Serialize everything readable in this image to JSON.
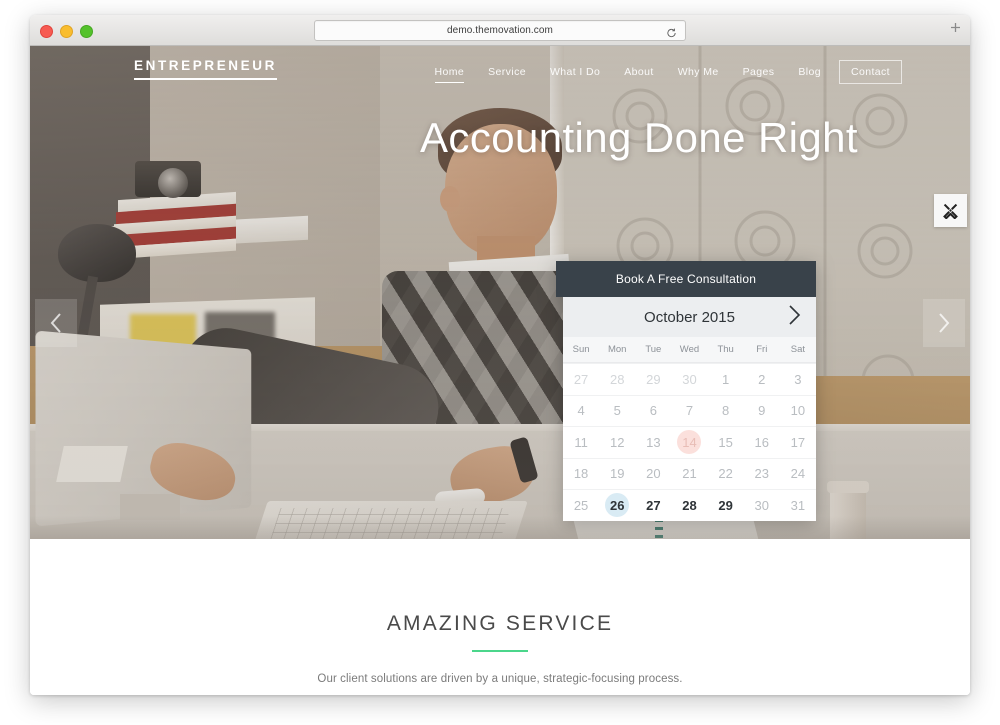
{
  "browser": {
    "url": "demo.themovation.com",
    "reload_icon": "reload-icon",
    "new_tab_icon": "plus-icon",
    "traffic_lights": [
      "close-red",
      "minimize-yellow",
      "maximize-green"
    ]
  },
  "header": {
    "logo": "ENTREPRENEUR",
    "nav": [
      {
        "label": "Home",
        "state": "active"
      },
      {
        "label": "Service",
        "state": "default"
      },
      {
        "label": "What I Do",
        "state": "default"
      },
      {
        "label": "About",
        "state": "default"
      },
      {
        "label": "Why Me",
        "state": "default"
      },
      {
        "label": "Pages",
        "state": "default"
      },
      {
        "label": "Blog",
        "state": "default"
      },
      {
        "label": "Contact",
        "state": "boxed"
      }
    ]
  },
  "hero": {
    "title": "Accounting Done Right",
    "prev_icon": "chevron-left-icon",
    "next_icon": "chevron-right-icon",
    "dots": [
      {
        "active": true
      },
      {
        "active": false
      }
    ],
    "tools_icon": "tools-icon"
  },
  "calendar": {
    "header": "Book A Free Consultation",
    "month": "October 2015",
    "next_icon": "chevron-right-icon",
    "weekdays": [
      "Sun",
      "Mon",
      "Tue",
      "Wed",
      "Thu",
      "Fri",
      "Sat"
    ],
    "days": [
      {
        "n": "27",
        "style": "muted"
      },
      {
        "n": "28",
        "style": "muted"
      },
      {
        "n": "29",
        "style": "muted"
      },
      {
        "n": "30",
        "style": "muted"
      },
      {
        "n": "1",
        "style": "normal"
      },
      {
        "n": "2",
        "style": "normal"
      },
      {
        "n": "3",
        "style": "normal"
      },
      {
        "n": "4",
        "style": "normal"
      },
      {
        "n": "5",
        "style": "normal"
      },
      {
        "n": "6",
        "style": "normal"
      },
      {
        "n": "7",
        "style": "normal"
      },
      {
        "n": "8",
        "style": "normal"
      },
      {
        "n": "9",
        "style": "normal"
      },
      {
        "n": "10",
        "style": "normal"
      },
      {
        "n": "11",
        "style": "normal"
      },
      {
        "n": "12",
        "style": "normal"
      },
      {
        "n": "13",
        "style": "normal"
      },
      {
        "n": "14",
        "style": "hl-pink"
      },
      {
        "n": "15",
        "style": "normal"
      },
      {
        "n": "16",
        "style": "normal"
      },
      {
        "n": "17",
        "style": "normal"
      },
      {
        "n": "18",
        "style": "normal"
      },
      {
        "n": "19",
        "style": "normal"
      },
      {
        "n": "20",
        "style": "normal"
      },
      {
        "n": "21",
        "style": "normal"
      },
      {
        "n": "22",
        "style": "normal"
      },
      {
        "n": "23",
        "style": "normal"
      },
      {
        "n": "24",
        "style": "normal"
      },
      {
        "n": "25",
        "style": "normal"
      },
      {
        "n": "26",
        "style": "hl-blue"
      },
      {
        "n": "27",
        "style": "dark"
      },
      {
        "n": "28",
        "style": "dark"
      },
      {
        "n": "29",
        "style": "dark"
      },
      {
        "n": "30",
        "style": "normal"
      },
      {
        "n": "31",
        "style": "normal"
      }
    ],
    "colors": {
      "header_bg": "#39424a",
      "highlight_pink": "#fbe0dc",
      "highlight_blue": "#d9ebf4"
    }
  },
  "section": {
    "title": "AMAZING SERVICE",
    "subtitle": "Our client solutions are driven by a unique, strategic-focusing process.",
    "rule_color": "#4bd68b"
  }
}
